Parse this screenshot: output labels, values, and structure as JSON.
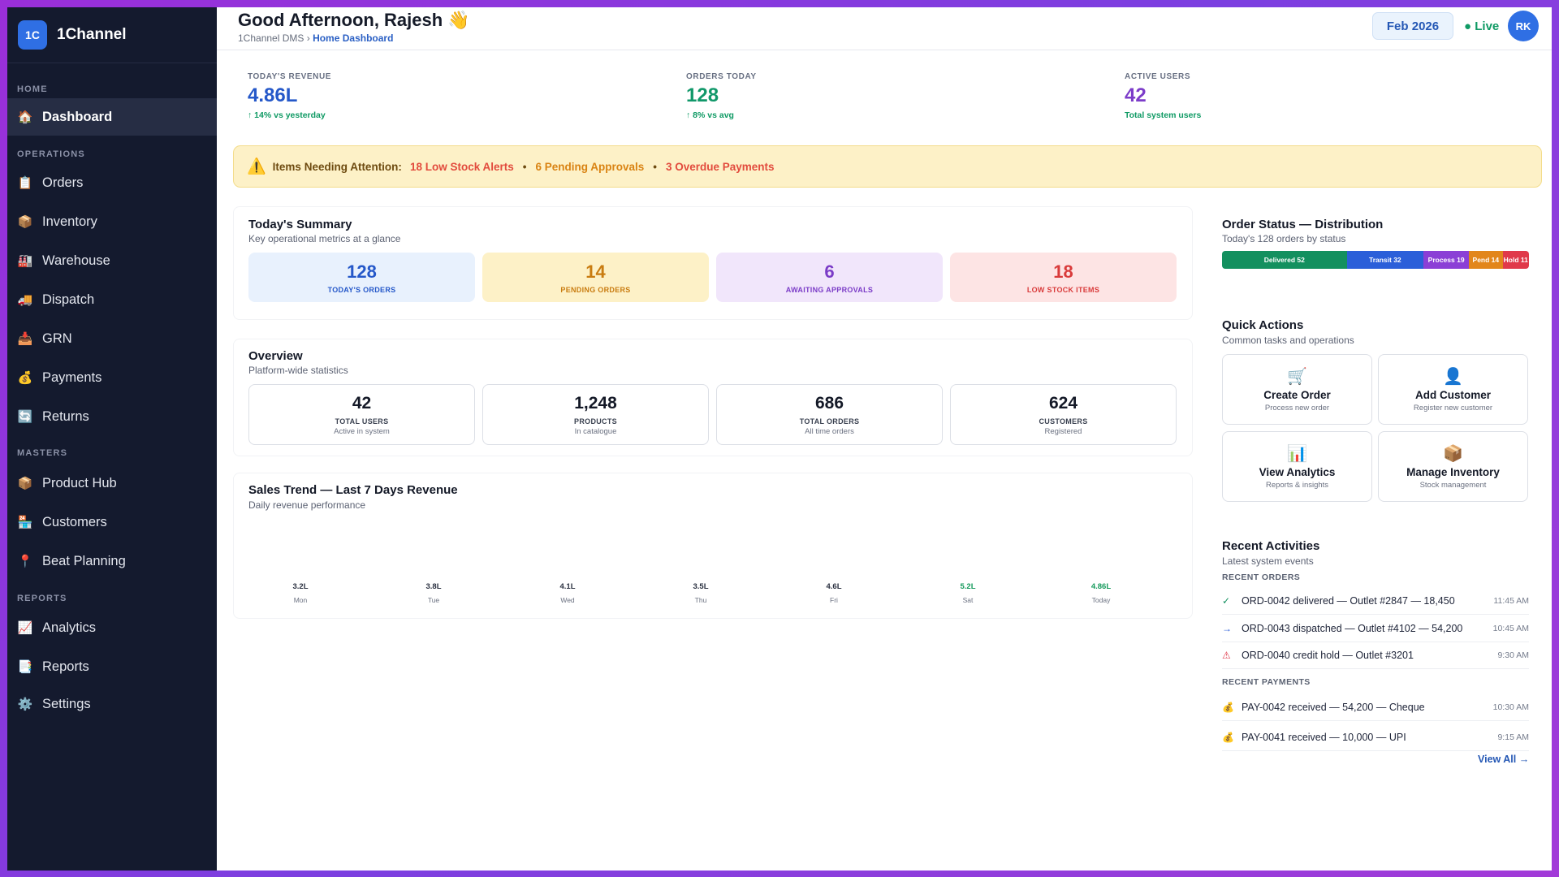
{
  "brand": {
    "logo": "1C",
    "name": "1Channel"
  },
  "sidebar": {
    "sections": [
      {
        "title": "HOME",
        "items": [
          {
            "label": "Dashboard",
            "icon": "🏠",
            "active": true
          }
        ]
      },
      {
        "title": "OPERATIONS",
        "items": [
          {
            "label": "Orders",
            "icon": "📋"
          },
          {
            "label": "Inventory",
            "icon": "📦"
          },
          {
            "label": "Warehouse",
            "icon": "🏭"
          },
          {
            "label": "Dispatch",
            "icon": "🚚"
          },
          {
            "label": "GRN",
            "icon": "📥"
          },
          {
            "label": "Payments",
            "icon": "💰"
          },
          {
            "label": "Returns",
            "icon": "🔄"
          }
        ]
      },
      {
        "title": "MASTERS",
        "items": [
          {
            "label": "Product Hub",
            "icon": "📦"
          },
          {
            "label": "Customers",
            "icon": "🏪"
          },
          {
            "label": "Beat Planning",
            "icon": "📍"
          }
        ]
      },
      {
        "title": "REPORTS",
        "items": [
          {
            "label": "Analytics",
            "icon": "📈"
          },
          {
            "label": "Reports",
            "icon": "📑"
          },
          {
            "label": "Settings",
            "icon": "⚙️"
          }
        ]
      }
    ]
  },
  "header": {
    "greeting": "Good Afternoon, Rajesh 👋",
    "crumb_root": "1Channel DMS",
    "crumb_sep": "›",
    "crumb_current": "Home Dashboard",
    "date": "Feb 2026",
    "live": "Live",
    "avatar": "RK"
  },
  "kpis": [
    {
      "label": "TODAY'S REVENUE",
      "value": "4.86L",
      "sub": "↑ 14% vs yesterday",
      "color": "#2558c9",
      "sub_color": "#0f9a64"
    },
    {
      "label": "ORDERS TODAY",
      "value": "128",
      "sub": "↑ 8% vs avg",
      "color": "#11986a",
      "sub_color": "#0f9a64"
    },
    {
      "label": "ACTIVE USERS",
      "value": "42",
      "sub": "Total system users",
      "color": "#7c3cc9",
      "sub_color": "#0f9a64"
    }
  ],
  "alert": {
    "icon": "⚠️",
    "prefix": "Items Needing Attention:",
    "low_stock": "18 Low Stock Alerts",
    "pending": "6 Pending Approvals",
    "overdue": "3 Overdue Payments",
    "sep": "•"
  },
  "summary": {
    "title": "Today's Summary",
    "subtitle": "Key operational metrics at a glance",
    "boxes": [
      {
        "value": "128",
        "label": "TODAY'S ORDERS",
        "bg": "#e8f1fd",
        "color": "#2558c9"
      },
      {
        "value": "14",
        "label": "PENDING ORDERS",
        "bg": "#fdf1c7",
        "color": "#c97c10"
      },
      {
        "value": "6",
        "label": "AWAITING APPROVALS",
        "bg": "#f1e6fb",
        "color": "#7b3cc7"
      },
      {
        "value": "18",
        "label": "LOW STOCK ITEMS",
        "bg": "#fde4e4",
        "color": "#d93b3b"
      }
    ]
  },
  "overview": {
    "title": "Overview",
    "subtitle": "Platform-wide statistics",
    "boxes": [
      {
        "value": "42",
        "label": "TOTAL USERS",
        "sub": "Active in system"
      },
      {
        "value": "1,248",
        "label": "PRODUCTS",
        "sub": "In catalogue"
      },
      {
        "value": "686",
        "label": "TOTAL ORDERS",
        "sub": "All time orders"
      },
      {
        "value": "624",
        "label": "CUSTOMERS",
        "sub": "Registered"
      }
    ]
  },
  "sales": {
    "title": "Sales Trend — Last 7 Days Revenue",
    "subtitle": "Daily revenue performance",
    "days": [
      {
        "value": "3.2L",
        "day": "Mon"
      },
      {
        "value": "3.8L",
        "day": "Tue"
      },
      {
        "value": "4.1L",
        "day": "Wed"
      },
      {
        "value": "3.5L",
        "day": "Thu"
      },
      {
        "value": "4.6L",
        "day": "Fri"
      },
      {
        "value": "5.2L",
        "day": "Sat",
        "highlight": true
      },
      {
        "value": "4.86L",
        "day": "Today",
        "highlight": true
      }
    ]
  },
  "order_status": {
    "title": "Order Status — Distribution",
    "subtitle": "Today's 128 orders by status",
    "segments": [
      {
        "label": "Delivered 52",
        "value": 52,
        "color": "#13905f"
      },
      {
        "label": "Transit 32",
        "value": 32,
        "color": "#2b5fd9"
      },
      {
        "label": "Process 19",
        "value": 19,
        "color": "#8b3fd6"
      },
      {
        "label": "Pend 14",
        "value": 14,
        "color": "#e2861b"
      },
      {
        "label": "Hold 11",
        "value": 11,
        "color": "#e0394a"
      }
    ]
  },
  "quick_actions": {
    "title": "Quick Actions",
    "subtitle": "Common tasks and operations",
    "items": [
      {
        "title": "Create Order",
        "sub": "Process new order",
        "icon": "🛒"
      },
      {
        "title": "Add Customer",
        "sub": "Register new customer",
        "icon": "👤"
      },
      {
        "title": "View Analytics",
        "sub": "Reports & insights",
        "icon": "📊"
      },
      {
        "title": "Manage Inventory",
        "sub": "Stock management",
        "icon": "📦"
      }
    ]
  },
  "activities": {
    "title": "Recent Activities",
    "subtitle": "Latest system events",
    "orders_title": "RECENT ORDERS",
    "orders": [
      {
        "icon": "✓",
        "icon_color": "#13905f",
        "text": "ORD-0042 delivered — Outlet #2847 — 18,450",
        "time": "11:45 AM"
      },
      {
        "icon": "→",
        "icon_color": "#2b5fd9",
        "text": "ORD-0043 dispatched — Outlet #4102 — 54,200",
        "time": "10:45 AM"
      },
      {
        "icon": "⚠",
        "icon_color": "#e0394a",
        "text": "ORD-0040 credit hold — Outlet #3201",
        "time": "9:30 AM"
      }
    ],
    "payments_title": "RECENT PAYMENTS",
    "payments": [
      {
        "icon": "💰",
        "icon_color": "#c97c10",
        "text": "PAY-0042 received — 54,200 — Cheque",
        "time": "10:30 AM"
      },
      {
        "icon": "💰",
        "icon_color": "#c97c10",
        "text": "PAY-0041 received — 10,000 — UPI",
        "time": "9:15 AM"
      }
    ],
    "view_all": "View All →"
  }
}
